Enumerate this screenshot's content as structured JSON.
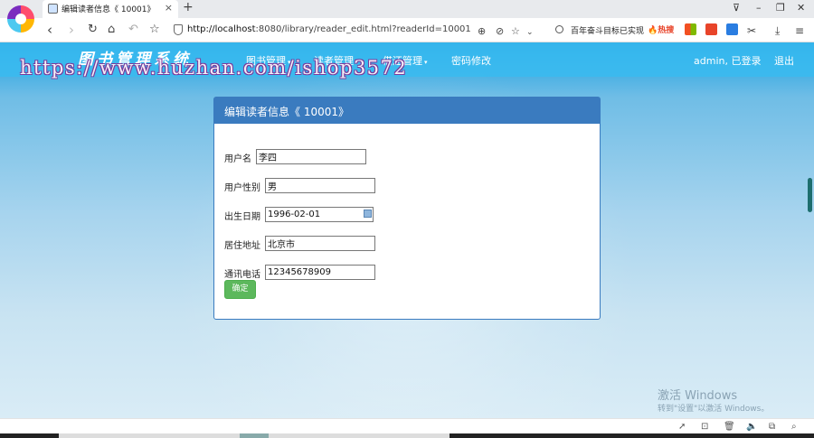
{
  "browser": {
    "tab_title": "编辑读者信息《 10001》",
    "tab_close": "×",
    "new_tab": "+",
    "url_host": "http://localhost",
    "url_rest": ":8080/library/reader_edit.html?readerId=10001",
    "search_text": "百年奋斗目标已实现",
    "search_hot": "🔥热搜",
    "window_controls": [
      "⊽",
      "–",
      "❐",
      "✕"
    ]
  },
  "navbar": {
    "brand": "图书管理系统",
    "watermark": "https://www.huzhan.com/ishop3572",
    "menu": [
      {
        "label": "图书管理",
        "caret": "▾"
      },
      {
        "label": "读者管理",
        "caret": "▾"
      },
      {
        "label": "借还管理",
        "caret": "▾"
      },
      {
        "label": "密码修改",
        "caret": ""
      }
    ],
    "user": "admin, 已登录",
    "logout": "退出"
  },
  "form": {
    "heading": "编辑读者信息《 10001》",
    "fields": [
      {
        "label": "用户名",
        "value": "李四"
      },
      {
        "label": "用户性别",
        "value": "男"
      },
      {
        "label": "出生日期",
        "value": "1996-02-01"
      },
      {
        "label": "居住地址",
        "value": "北京市"
      },
      {
        "label": "通讯电话",
        "value": "12345678909"
      }
    ],
    "submit": "确定"
  },
  "system": {
    "activate_title": "激活 Windows",
    "activate_sub": "转到\"设置\"以激活 Windows。"
  },
  "colors": {
    "navbar": "#3abbf0",
    "panel_header": "#3a7bbf",
    "submit": "#5cb85c"
  }
}
